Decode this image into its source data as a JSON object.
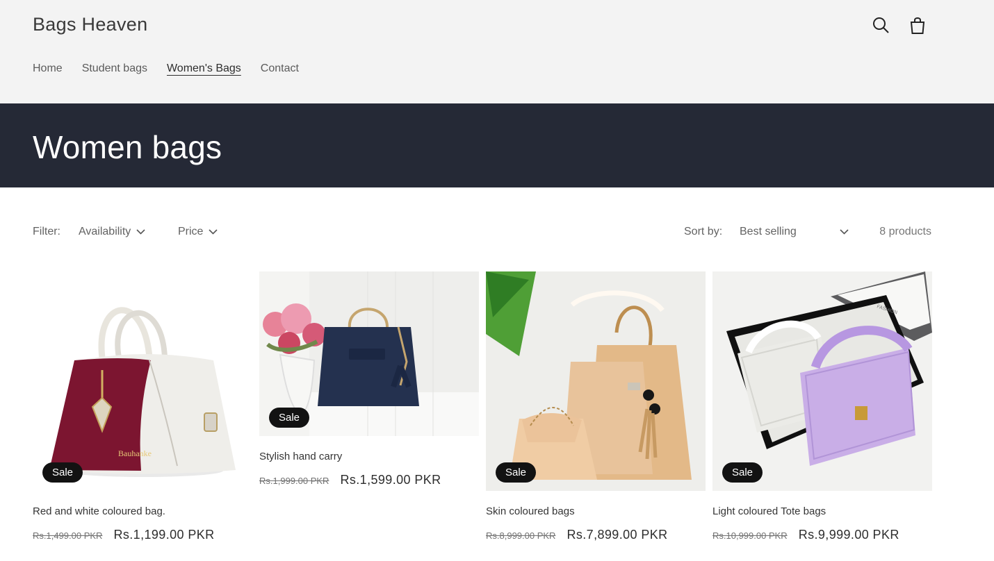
{
  "header": {
    "store_name": "Bags Heaven",
    "nav": [
      {
        "label": "Home"
      },
      {
        "label": "Student bags"
      },
      {
        "label": "Women's Bags"
      },
      {
        "label": "Contact"
      }
    ],
    "icons": {
      "search": "search-icon",
      "cart": "shopping-bag-icon"
    }
  },
  "collection": {
    "title": "Women bags"
  },
  "filters": {
    "label": "Filter:",
    "availability": "Availability",
    "price": "Price",
    "sort_label": "Sort by:",
    "sort_value": "Best selling",
    "count": "8 products"
  },
  "products": [
    {
      "title": "Red and white coloured bag.",
      "old_price": "Rs.1,499.00 PKR",
      "price": "Rs.1,199.00 PKR",
      "badge": "Sale"
    },
    {
      "title": "Stylish hand carry",
      "old_price": "Rs.1,999.00 PKR",
      "price": "Rs.1,599.00 PKR",
      "badge": "Sale"
    },
    {
      "title": "Skin coloured bags",
      "old_price": "Rs.8,999.00 PKR",
      "price": "Rs.7,899.00 PKR",
      "badge": "Sale"
    },
    {
      "title": "Light coloured Tote bags",
      "old_price": "Rs.10,999.00 PKR",
      "price": "Rs.9,999.00 PKR",
      "badge": "Sale"
    }
  ],
  "colors": {
    "header_bg": "#f3f3f3",
    "banner_bg": "#252936",
    "badge_bg": "#121212"
  }
}
